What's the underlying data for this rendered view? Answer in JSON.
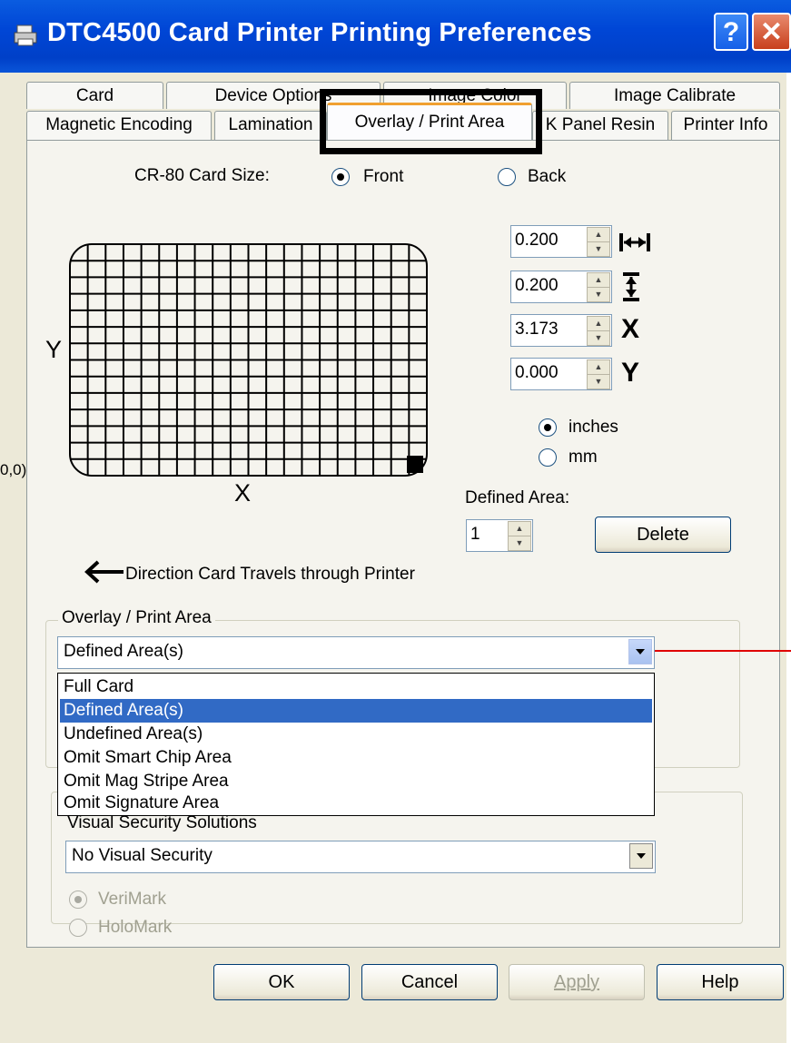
{
  "window": {
    "title": "DTC4500 Card Printer Printing Preferences",
    "help_glyph": "?",
    "close_glyph": "✕"
  },
  "tabs_row1": [
    "Card",
    "Device Options",
    "Image Color",
    "Image Calibrate"
  ],
  "tabs_row2": [
    "Magnetic Encoding",
    "Lamination",
    "Overlay / Print Area",
    "K Panel Resin",
    "Printer Info"
  ],
  "card_size": {
    "label": "CR-80 Card Size:",
    "front": "Front",
    "back": "Back",
    "selected": "Front"
  },
  "spinners": [
    {
      "value": "0.200",
      "icon": "width-arrows-icon"
    },
    {
      "value": "0.200",
      "icon": "height-arrows-icon"
    },
    {
      "value": "3.173",
      "icon_text": "X"
    },
    {
      "value": "0.000",
      "icon_text": "Y"
    }
  ],
  "units": {
    "inches": "inches",
    "mm": "mm",
    "selected": "inches"
  },
  "grid": {
    "y_label": "Y",
    "x_label": "X",
    "origin_label": "0,0)"
  },
  "defined_area": {
    "label": "Defined Area:",
    "value": "1",
    "delete_label": "Delete"
  },
  "direction": {
    "text": "Direction Card Travels through Printer"
  },
  "overlay_group": {
    "legend": "Overlay / Print Area",
    "selected": "Defined Area(s)",
    "options": [
      "Full Card",
      "Defined Area(s)",
      "Undefined Area(s)",
      "Omit Smart Chip Area",
      "Omit Mag Stripe Area",
      "Omit Signature Area"
    ]
  },
  "security_group": {
    "legend": "Visual Security Solutions",
    "selected": "No Visual Security",
    "verimark": "VeriMark",
    "holomark": "HoloMark"
  },
  "buttons": {
    "ok": "OK",
    "cancel": "Cancel",
    "apply": "Apply",
    "help": "Help"
  },
  "colors": {
    "titlebar": "#0046d6",
    "selection": "#316ac5",
    "callout_line": "#e00000",
    "window_bg": "#ece9d8"
  }
}
